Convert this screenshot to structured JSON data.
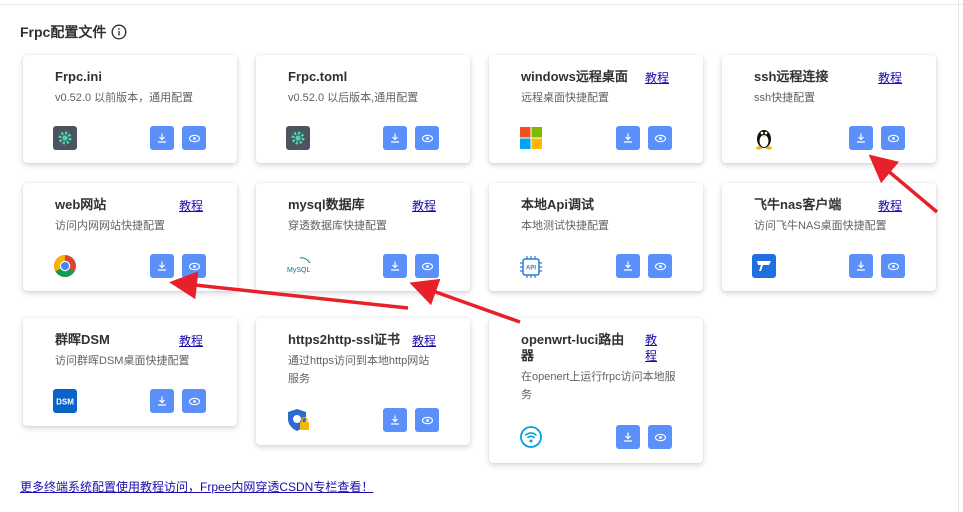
{
  "section_title": "Frpc配置文件",
  "tutorial_label": "教程",
  "cards": [
    {
      "title": "Frpc.ini",
      "desc": "v0.52.0 以前版本，通用配置",
      "icon": "gear-icon"
    },
    {
      "title": "Frpc.toml",
      "desc": "v0.52.0 以后版本,通用配置",
      "icon": "gear-icon"
    },
    {
      "title": "windows远程桌面",
      "desc": "远程桌面快捷配置",
      "icon": "windows-logo-icon"
    },
    {
      "title": "ssh远程连接",
      "desc": "ssh快捷配置",
      "icon": "linux-penguin-icon"
    },
    {
      "title": "web网站",
      "desc": "访问内网网站快捷配置",
      "icon": "chrome-logo-icon"
    },
    {
      "title": "mysql数据库",
      "desc": "穿透数据库快捷配置",
      "icon": "mysql-logo-icon",
      "logo_text": "MySQL"
    },
    {
      "title": "本地Api调试",
      "desc": "本地测试快捷配置",
      "icon": "api-chip-icon",
      "logo_text": "API"
    },
    {
      "title": "飞牛nas客户端",
      "desc": "访问飞牛NAS桌面快捷配置",
      "icon": "fnos-logo-icon"
    },
    {
      "title": "群晖DSM",
      "desc": "访问群晖DSM桌面快捷配置",
      "icon": "dsm-logo-icon",
      "logo_text": "DSM"
    },
    {
      "title": "https2http-ssl证书",
      "desc": "通过https访问到本地http网站服务",
      "icon": "shield-lock-icon"
    },
    {
      "title": "openwrt-luci路由器",
      "desc": "在openert上运行frpc访问本地服务",
      "icon": "openwrt-wifi-icon"
    }
  ],
  "bottom_link": "更多终端系统配置使用教程访问，Frpee内网穿透CSDN专栏查看！",
  "colors": {
    "button": "#5b8ff9",
    "arrow": "#e8202a",
    "link": "#1a0dab"
  }
}
